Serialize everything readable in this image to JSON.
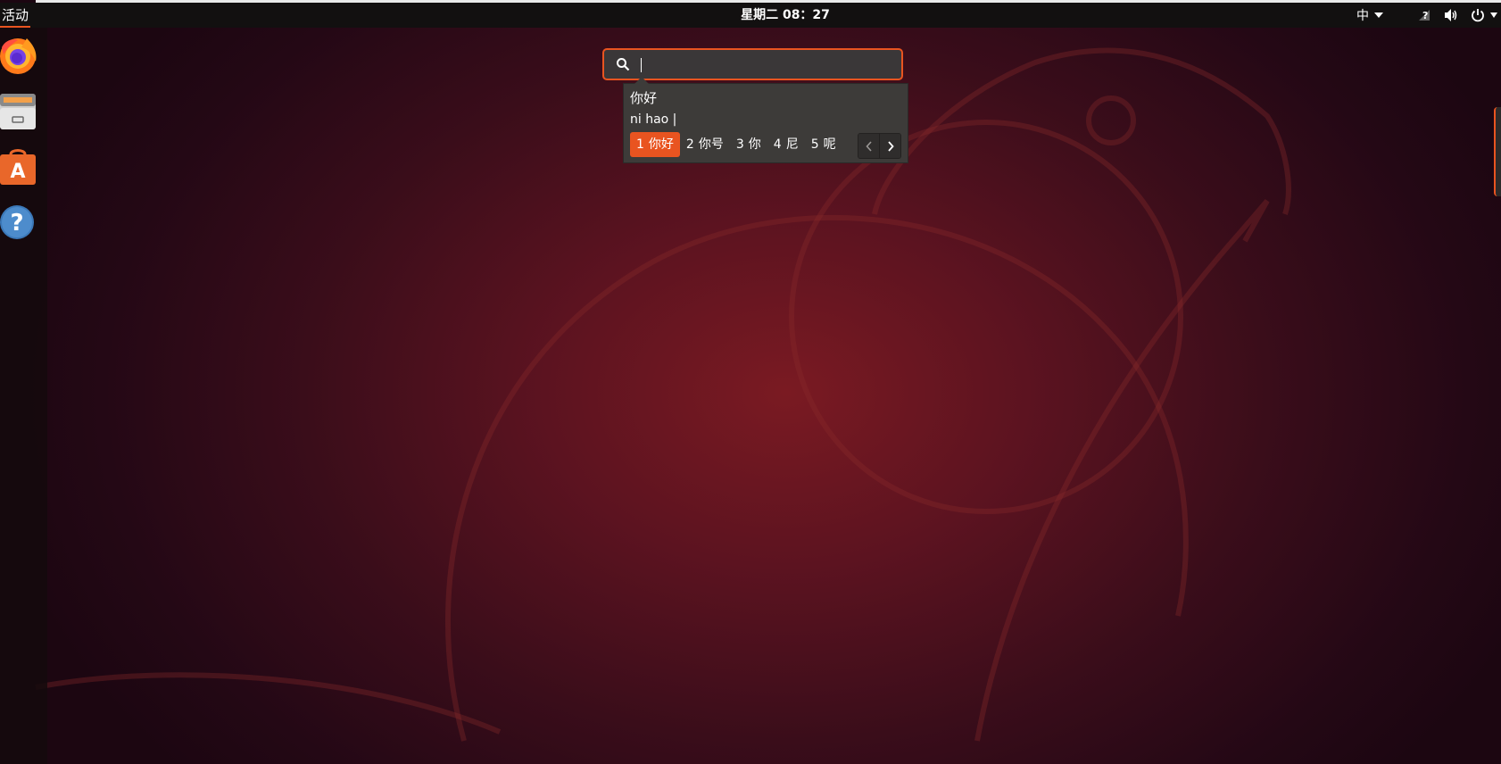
{
  "topbar": {
    "activities_label": "活动",
    "clock": "星期二 08：27",
    "input_method": "中",
    "network_icon": "network-unknown-icon",
    "volume_icon": "volume-icon",
    "power_icon": "power-icon"
  },
  "dock": {
    "items": [
      {
        "name": "Firefox",
        "icon": "firefox-icon"
      },
      {
        "name": "Files",
        "icon": "files-icon"
      },
      {
        "name": "Ubuntu Software",
        "icon": "software-center-icon"
      },
      {
        "name": "Help",
        "icon": "help-icon"
      }
    ]
  },
  "search": {
    "value": "",
    "icon": "search-icon"
  },
  "ime": {
    "preedit": "你好",
    "pinyin": "ni hao |",
    "candidates": [
      {
        "num": "1",
        "text": "你好",
        "selected": true
      },
      {
        "num": "2",
        "text": "你号",
        "selected": false
      },
      {
        "num": "3",
        "text": "你",
        "selected": false
      },
      {
        "num": "4",
        "text": "尼",
        "selected": false
      },
      {
        "num": "5",
        "text": "呢",
        "selected": false
      }
    ]
  },
  "colors": {
    "accent": "#e95420",
    "topbar": "#121010",
    "popup": "#3d3b39"
  }
}
